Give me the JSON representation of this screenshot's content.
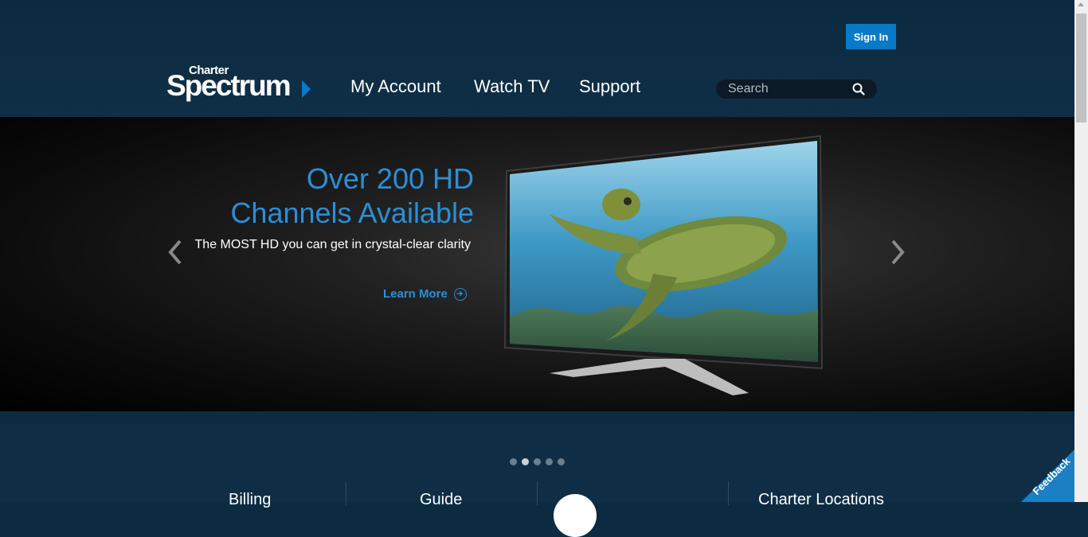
{
  "header": {
    "sign_in": "Sign In",
    "logo": {
      "small": "Charter",
      "big": "Spectrum"
    },
    "nav": [
      {
        "label": "My Account"
      },
      {
        "label": "Watch TV"
      },
      {
        "label": "Support"
      }
    ],
    "search": {
      "placeholder": "Search",
      "icon": "search-icon"
    }
  },
  "hero": {
    "title_line1": "Over 200 HD",
    "title_line2": "Channels Available",
    "subtitle": "The MOST HD you can get in crystal-clear clarity",
    "cta": "Learn More",
    "prev_icon": "chevron-left-icon",
    "next_icon": "chevron-right-icon"
  },
  "carousel": {
    "dot_count": 5,
    "active_index": 1
  },
  "bottom": {
    "columns": [
      {
        "label": "Billing"
      },
      {
        "label": "Guide"
      },
      {
        "label": "Charter Locations"
      }
    ]
  },
  "feedback": "Feedback",
  "colors": {
    "accent": "#0a7ac6",
    "header_bg": "#0c2a3f",
    "link_blue": "#2b8fd6"
  }
}
